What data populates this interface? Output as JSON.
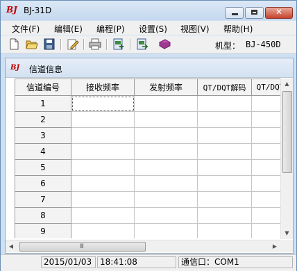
{
  "window": {
    "logo": "BJ",
    "title": "BJ-31D",
    "controls": {
      "minimize": "–",
      "maximize": "□",
      "close": "✕"
    }
  },
  "menu": [
    {
      "label": "文件(F)"
    },
    {
      "label": "编辑(E)"
    },
    {
      "label": "编程(P)"
    },
    {
      "label": "设置(S)"
    },
    {
      "label": "视图(V)"
    },
    {
      "label": "帮助(H)"
    }
  ],
  "toolbar": {
    "buttons": [
      "new-file-icon",
      "open-folder-icon",
      "save-icon",
      "edit-icon",
      "print-icon",
      "read-from-radio-icon",
      "write-to-radio-icon",
      "help-book-icon"
    ],
    "model_label": "机型：",
    "model_value": "BJ-450D"
  },
  "document": {
    "logo": "BJ",
    "title": "信道信息"
  },
  "table": {
    "headers": [
      "信道编号",
      "接收频率",
      "发射频率",
      "QT/DQT解码",
      "QT/DQT"
    ],
    "rows": [
      [
        "1",
        "",
        "",
        "",
        ""
      ],
      [
        "2",
        "",
        "",
        "",
        ""
      ],
      [
        "3",
        "",
        "",
        "",
        ""
      ],
      [
        "4",
        "",
        "",
        "",
        ""
      ],
      [
        "5",
        "",
        "",
        "",
        ""
      ],
      [
        "6",
        "",
        "",
        "",
        ""
      ],
      [
        "7",
        "",
        "",
        "",
        ""
      ],
      [
        "8",
        "",
        "",
        "",
        ""
      ],
      [
        "9",
        "",
        "",
        "",
        ""
      ]
    ],
    "scroll_arrows": {
      "up": "▲",
      "down": "▼",
      "left": "◀",
      "right": "▶"
    },
    "grip": "III"
  },
  "status": {
    "date": "2015/01/03",
    "time": "18:41:08",
    "port": "通信口：COM1"
  },
  "colors": {
    "logo_red": "#c00000",
    "titlebar": "#c4d8ef",
    "close_button": "#c7432e"
  }
}
